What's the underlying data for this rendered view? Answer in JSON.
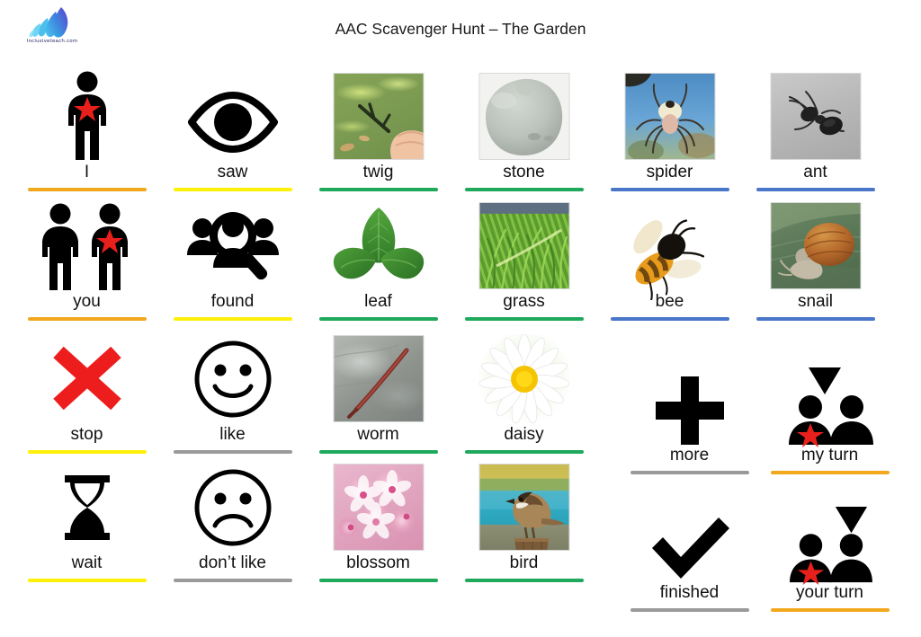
{
  "page": {
    "title": "AAC Scavenger Hunt – The Garden",
    "logo_wordmark": "Inclusiveteach.com",
    "logo_icon": "leaf-feather-logo",
    "background_color": "#ffffff"
  },
  "rule_colors": {
    "orange": "#F2A81D",
    "yellow": "#FFF00A",
    "green": "#1FA95C",
    "blue": "#4A76C9",
    "grey": "#9A9A9A"
  },
  "grid": {
    "columns": 6,
    "rows": 4,
    "core_words_columns": [
      1,
      2
    ],
    "photo_columns": [
      3,
      4,
      5,
      6
    ]
  },
  "cells": [
    {
      "id": "i",
      "label": "I",
      "icon": "person-star-icon",
      "kind": "symbol",
      "rule": "orange",
      "row": 1,
      "col": 1
    },
    {
      "id": "saw",
      "label": "saw",
      "icon": "eye-icon",
      "kind": "symbol",
      "rule": "yellow",
      "row": 1,
      "col": 2
    },
    {
      "id": "twig",
      "label": "twig",
      "icon": "twig-photo",
      "kind": "photo",
      "rule": "green",
      "row": 1,
      "col": 3
    },
    {
      "id": "stone",
      "label": "stone",
      "icon": "stone-photo",
      "kind": "photo",
      "rule": "green",
      "row": 1,
      "col": 4
    },
    {
      "id": "spider",
      "label": "spider",
      "icon": "spider-photo",
      "kind": "photo",
      "rule": "blue",
      "row": 1,
      "col": 5
    },
    {
      "id": "ant",
      "label": "ant",
      "icon": "ant-photo",
      "kind": "photo",
      "rule": "blue",
      "row": 1,
      "col": 6
    },
    {
      "id": "you",
      "label": "you",
      "icon": "two-people-star-icon",
      "kind": "symbol",
      "rule": "orange",
      "row": 2,
      "col": 1
    },
    {
      "id": "found",
      "label": "found",
      "icon": "magnifier-people-icon",
      "kind": "symbol",
      "rule": "yellow",
      "row": 2,
      "col": 2
    },
    {
      "id": "leaf",
      "label": "leaf",
      "icon": "leaf-cutout",
      "kind": "cutout",
      "rule": "green",
      "row": 2,
      "col": 3
    },
    {
      "id": "grass",
      "label": "grass",
      "icon": "grass-photo",
      "kind": "photo",
      "rule": "green",
      "row": 2,
      "col": 4
    },
    {
      "id": "bee",
      "label": "bee",
      "icon": "bee-cutout",
      "kind": "cutout",
      "rule": "blue",
      "row": 2,
      "col": 5
    },
    {
      "id": "snail",
      "label": "snail",
      "icon": "snail-photo",
      "kind": "photo",
      "rule": "blue",
      "row": 2,
      "col": 6
    },
    {
      "id": "stop",
      "label": "stop",
      "icon": "red-cross-icon",
      "kind": "symbol",
      "rule": "yellow",
      "row": 3,
      "col": 1
    },
    {
      "id": "like",
      "label": "like",
      "icon": "happy-face-icon",
      "kind": "symbol",
      "rule": "grey",
      "row": 3,
      "col": 2
    },
    {
      "id": "worm",
      "label": "worm",
      "icon": "worm-photo",
      "kind": "photo",
      "rule": "green",
      "row": 3,
      "col": 3
    },
    {
      "id": "daisy",
      "label": "daisy",
      "icon": "daisy-cutout",
      "kind": "cutout",
      "rule": "green",
      "row": 3,
      "col": 4
    },
    {
      "id": "more",
      "label": "more",
      "icon": "plus-icon",
      "kind": "symbol",
      "rule": "grey",
      "row": 3,
      "col": 5
    },
    {
      "id": "my-turn",
      "label": "my turn",
      "icon": "my-turn-icon",
      "kind": "symbol",
      "rule": "orange",
      "row": 3,
      "col": 6
    },
    {
      "id": "wait",
      "label": "wait",
      "icon": "hourglass-icon",
      "kind": "symbol",
      "rule": "yellow",
      "row": 4,
      "col": 1
    },
    {
      "id": "dont-like",
      "label": "don’t like",
      "icon": "sad-face-icon",
      "kind": "symbol",
      "rule": "grey",
      "row": 4,
      "col": 2
    },
    {
      "id": "blossom",
      "label": "blossom",
      "icon": "blossom-photo",
      "kind": "photo",
      "rule": "green",
      "row": 4,
      "col": 3
    },
    {
      "id": "bird",
      "label": "bird",
      "icon": "bird-photo",
      "kind": "photo",
      "rule": "green",
      "row": 4,
      "col": 4
    },
    {
      "id": "finished",
      "label": "finished",
      "icon": "checkmark-icon",
      "kind": "symbol",
      "rule": "grey",
      "row": 4,
      "col": 5
    },
    {
      "id": "your-turn",
      "label": "your turn",
      "icon": "your-turn-icon",
      "kind": "symbol",
      "rule": "orange",
      "row": 4,
      "col": 6
    }
  ]
}
